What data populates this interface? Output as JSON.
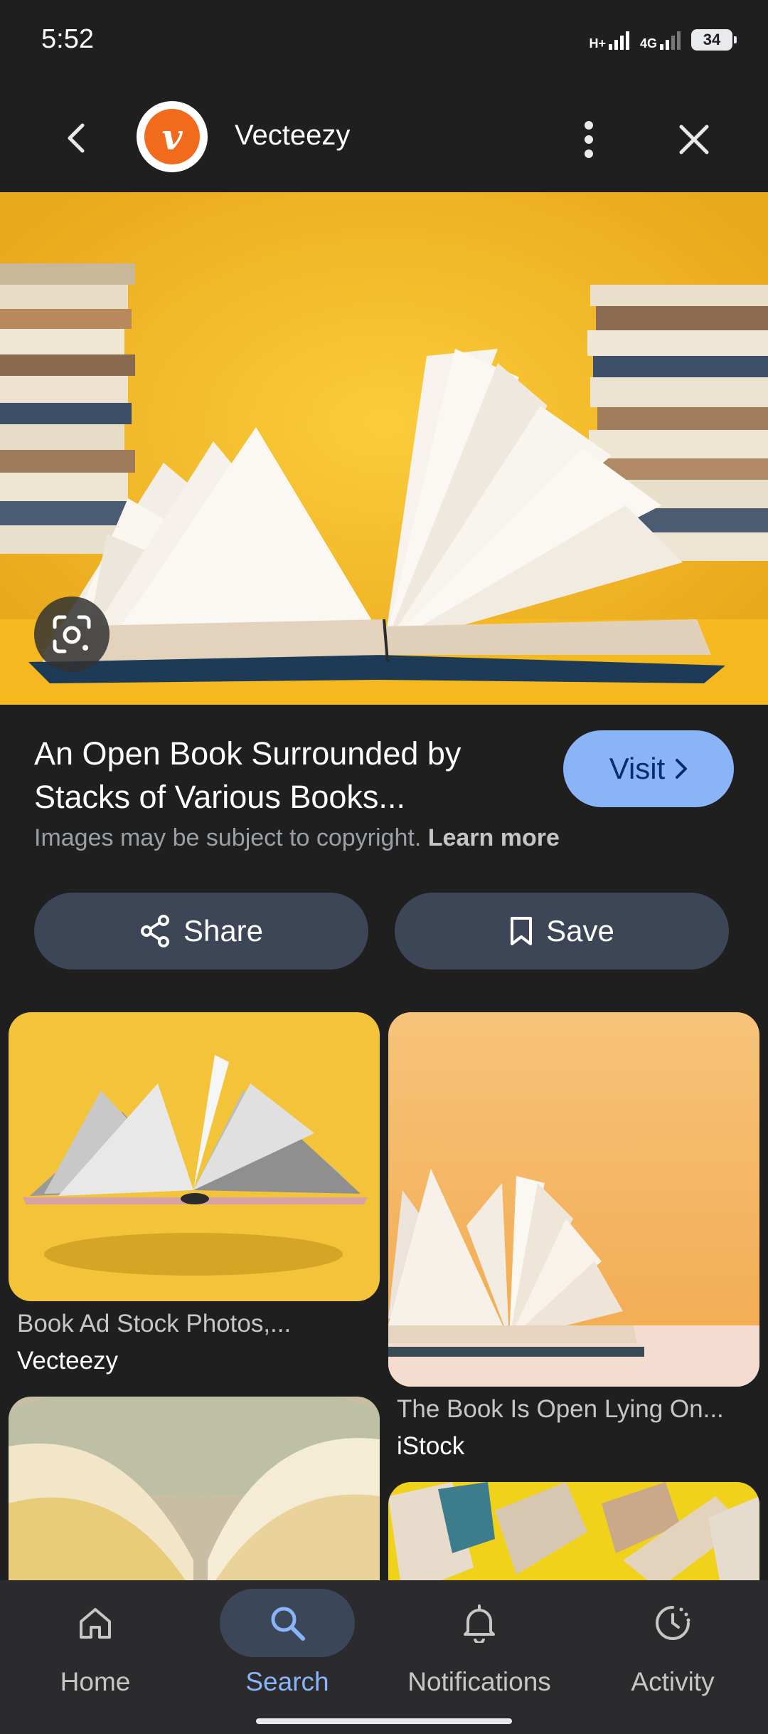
{
  "status_bar": {
    "time": "5:52",
    "network1": "H+",
    "network2": "4G",
    "battery": "34"
  },
  "header": {
    "site_name": "Vecteezy",
    "logo_letter": "v"
  },
  "result": {
    "title": "An Open Book Surrounded by Stacks of Various Books...",
    "copyright_text": "Images may be subject to copyright.",
    "learn_more": "Learn more",
    "visit_label": "Visit"
  },
  "actions": {
    "share_label": "Share",
    "save_label": "Save"
  },
  "related": [
    {
      "caption": "Book Ad Stock Photos,...",
      "source": "Vecteezy"
    },
    {
      "caption": "The Book Is Open Lying On...",
      "source": "iStock"
    }
  ],
  "bottom_nav": {
    "items": [
      {
        "label": "Home",
        "icon": "home-icon"
      },
      {
        "label": "Search",
        "icon": "search-icon"
      },
      {
        "label": "Notifications",
        "icon": "bell-icon"
      },
      {
        "label": "Activity",
        "icon": "activity-icon"
      }
    ],
    "active": "Search"
  },
  "colors": {
    "background": "#1f1f1f",
    "accent": "#8ab4f8",
    "button_bg": "#3c4656",
    "hero_bg": "#f1b928",
    "logo": "#f26b1d"
  }
}
